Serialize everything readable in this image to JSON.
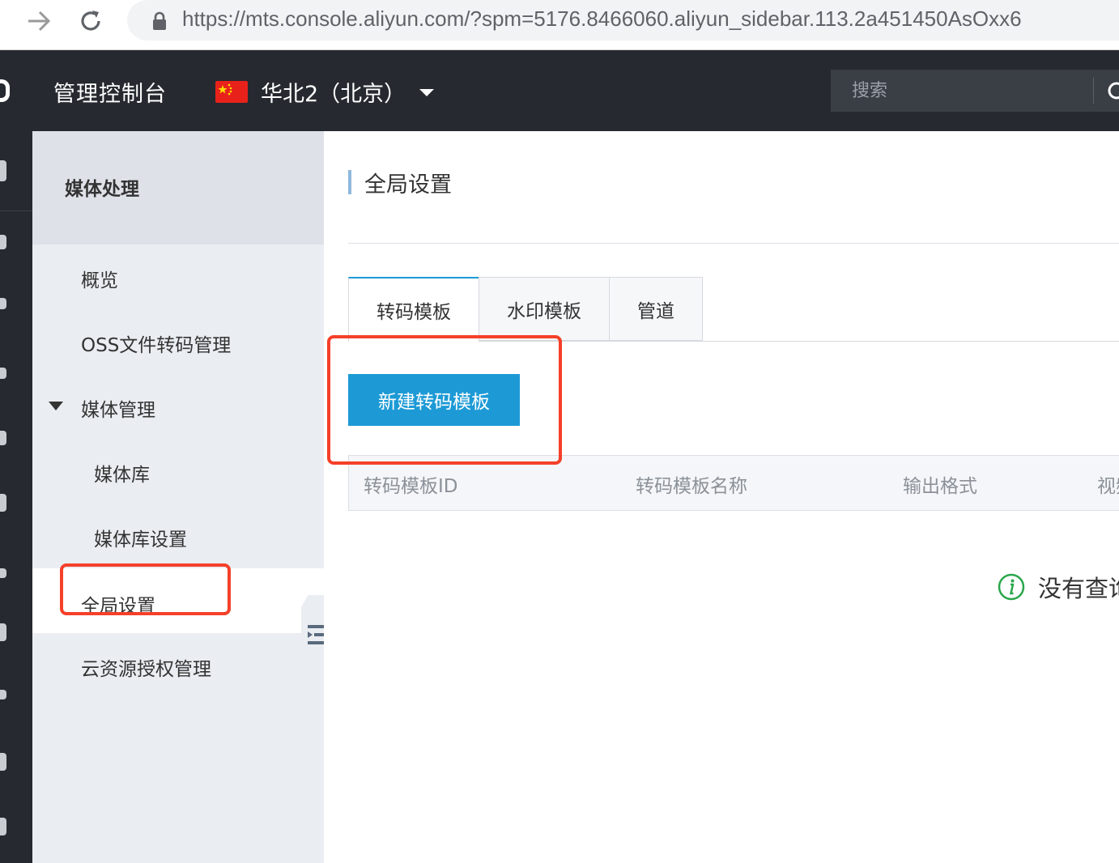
{
  "browser": {
    "url_host": "https://mts.console.aliyun.com",
    "url_path": "/?spm=5176.8466060.aliyun_sidebar.113.2a451450AsOxx6"
  },
  "topbar": {
    "console_title": "管理控制台",
    "region": "华北2（北京）",
    "search_placeholder": "搜索"
  },
  "sidebar": {
    "title": "媒体处理",
    "items": [
      {
        "label": "概览"
      },
      {
        "label": "OSS文件转码管理"
      },
      {
        "label": "媒体管理"
      },
      {
        "label": "媒体库"
      },
      {
        "label": "媒体库设置"
      },
      {
        "label": "全局设置"
      },
      {
        "label": "云资源授权管理"
      }
    ]
  },
  "main": {
    "page_title": "全局设置",
    "tabs": [
      {
        "label": "转码模板"
      },
      {
        "label": "水印模板"
      },
      {
        "label": "管道"
      }
    ],
    "new_button": "新建转码模板",
    "columns": [
      "转码模板ID",
      "转码模板名称",
      "输出格式",
      "视频"
    ],
    "empty_text": "没有查询"
  },
  "colors": {
    "accent": "#1d9ad6",
    "topbar_bg": "#26292f",
    "highlight": "#f5402a",
    "info_green": "#2aa64b"
  }
}
